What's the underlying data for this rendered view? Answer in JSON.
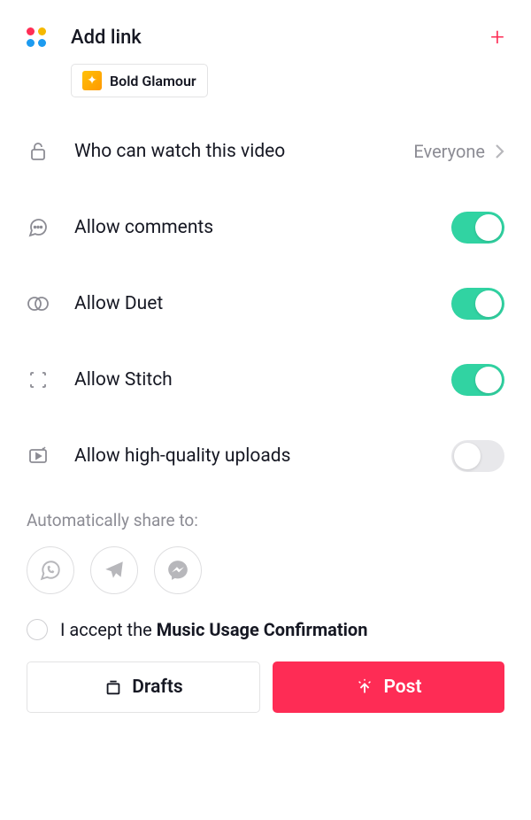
{
  "header": {
    "title": "Add link"
  },
  "filter": {
    "label": "Bold Glamour"
  },
  "privacy": {
    "label": "Who can watch this video",
    "value": "Everyone"
  },
  "toggles": {
    "comments": {
      "label": "Allow comments",
      "on": true
    },
    "duet": {
      "label": "Allow Duet",
      "on": true
    },
    "stitch": {
      "label": "Allow Stitch",
      "on": true
    },
    "hq": {
      "label": "Allow high-quality uploads",
      "on": false
    }
  },
  "share": {
    "label": "Automatically share to:"
  },
  "accept": {
    "prefix": "I accept the ",
    "bold": "Music Usage Confirmation"
  },
  "buttons": {
    "drafts": "Drafts",
    "post": "Post"
  }
}
